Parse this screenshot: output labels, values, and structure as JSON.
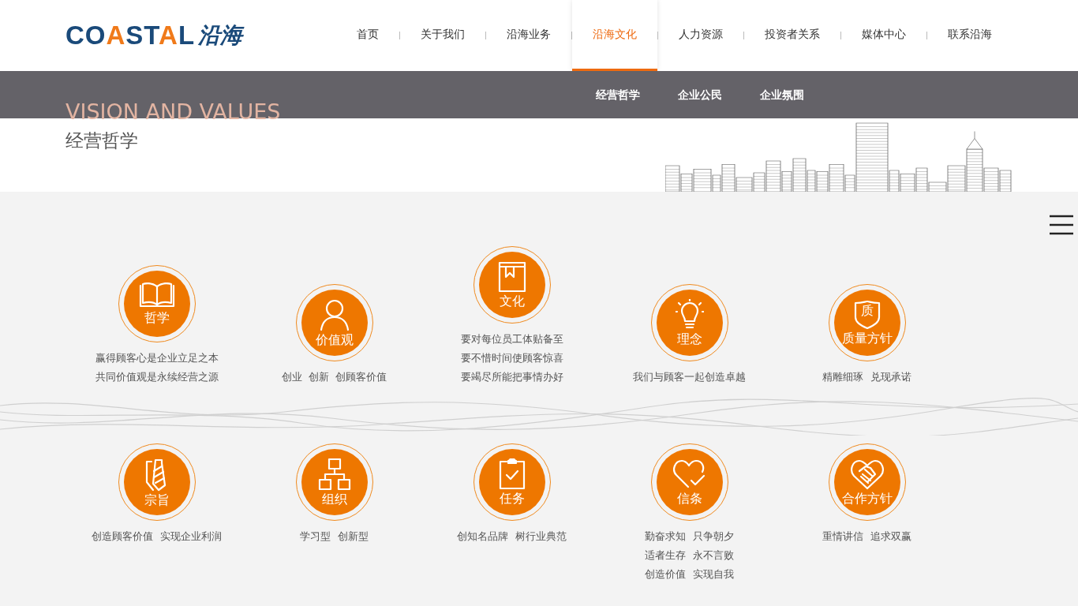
{
  "logo": {
    "parts": [
      {
        "text": "CO",
        "accent": false
      },
      {
        "text": "A",
        "accent": true
      },
      {
        "text": "ST",
        "accent": false
      },
      {
        "text": "A",
        "accent": true
      },
      {
        "text": "L",
        "accent": false
      }
    ],
    "script": "沿海"
  },
  "nav": [
    {
      "label": "首页",
      "selected": false
    },
    {
      "label": "关于我们",
      "selected": false
    },
    {
      "label": "沿海业务",
      "selected": false
    },
    {
      "label": "沿海文化",
      "selected": true
    },
    {
      "label": "人力资源",
      "selected": false
    },
    {
      "label": "投资者关系",
      "selected": false
    },
    {
      "label": "媒体中心",
      "selected": false
    },
    {
      "label": "联系沿海",
      "selected": false
    }
  ],
  "subnav": [
    {
      "label": "经营哲学"
    },
    {
      "label": "企业公民"
    },
    {
      "label": "企业氛围"
    }
  ],
  "banner": {
    "title_en": "VISION AND VALUES",
    "title": "经营哲学"
  },
  "values_top": [
    {
      "label": "哲学",
      "kind": "book",
      "lines": [
        "赢得顾客心是企业立足之本",
        "共同价值观是永续经营之源"
      ]
    },
    {
      "label": "价值观",
      "kind": "person",
      "lines": [
        "创业  创新  创顾客价值"
      ]
    },
    {
      "label": "文化",
      "kind": "bookmark",
      "lines": [
        "要对每位员工体贴备至",
        "要不惜时间使顾客惊喜",
        "要竭尽所能把事情办好"
      ]
    },
    {
      "label": "理念",
      "kind": "bulb",
      "lines": [
        "我们与顾客一起创造卓越"
      ]
    },
    {
      "label": "质量方针",
      "kind": "shield",
      "icon_text": "质",
      "lines": [
        "精雕细琢  兑现承诺"
      ]
    }
  ],
  "values_bottom": [
    {
      "label": "宗旨",
      "kind": "tie",
      "lines": [
        "创造顾客价值  实现企业利润"
      ]
    },
    {
      "label": "组织",
      "kind": "org",
      "lines": [
        "学习型  创新型"
      ]
    },
    {
      "label": "任务",
      "kind": "clipboard",
      "lines": [
        "创知名品牌  树行业典范"
      ]
    },
    {
      "label": "信条",
      "kind": "heart",
      "lines": [
        "勤奋求知  只争朝夕",
        "适者生存  永不言败",
        "创造价值  实现自我"
      ]
    },
    {
      "label": "合作方针",
      "kind": "handshake",
      "lines": [
        "重情讲信  追求双赢"
      ]
    }
  ]
}
